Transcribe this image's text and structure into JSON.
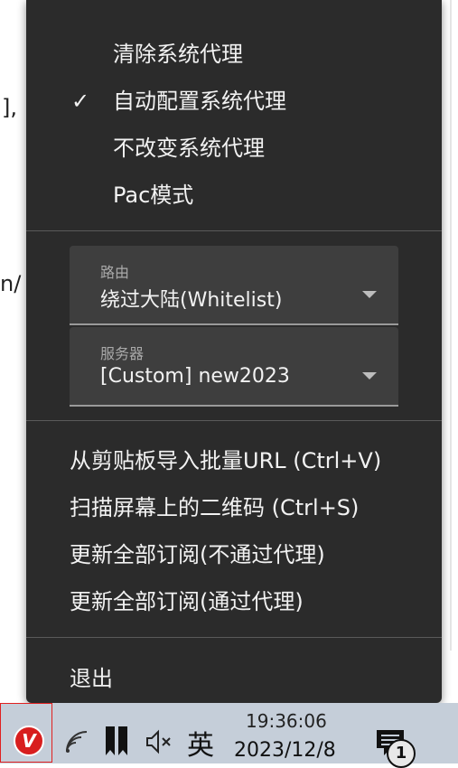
{
  "background": {
    "char1": "],",
    "char2": "n/"
  },
  "menu": {
    "proxy_modes": [
      {
        "label": "清除系统代理",
        "checked": false
      },
      {
        "label": "自动配置系统代理",
        "checked": true
      },
      {
        "label": "不改变系统代理",
        "checked": false
      },
      {
        "label": "Pac模式",
        "checked": false
      }
    ],
    "check_mark": "✓",
    "routing": {
      "label": "路由",
      "value": "绕过大陆(Whitelist)"
    },
    "server": {
      "label": "服务器",
      "value": "[Custom] new2023"
    },
    "actions": [
      "从剪贴板导入批量URL (Ctrl+V)",
      "扫描屏幕上的二维码 (Ctrl+S)",
      "更新全部订阅(不通过代理)",
      "更新全部订阅(通过代理)"
    ],
    "exit": "退出"
  },
  "taskbar": {
    "app_icon_letter": "V",
    "ime": "英",
    "time": "19:36:06",
    "date": "2023/12/8",
    "notification_count": "1"
  },
  "colors": {
    "menu_bg": "#2b2b2b",
    "taskbar_bg": "#c5ced9",
    "highlight": "#e02020",
    "app_red": "#d81e1e"
  }
}
